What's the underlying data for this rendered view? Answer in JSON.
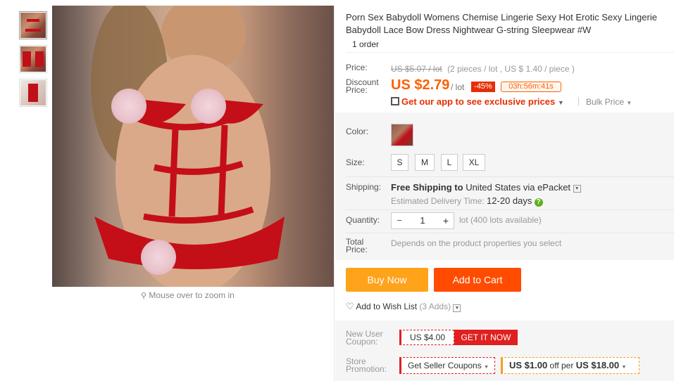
{
  "gallery": {
    "zoom_hint": "Mouse over to zoom in"
  },
  "product": {
    "title": "Porn Sex Babydoll Womens Chemise Lingerie Sexy Hot Erotic Sexy Lingerie Babydoll Lace Bow Dress Nightwear G-string Sleepwear #W",
    "orders": "1 order"
  },
  "price": {
    "label": "Price:",
    "original": "US $5.07 / lot",
    "original_note": "(2 pieces / lot , US $ 1.40 / piece )",
    "discount_label": "Discount Price:",
    "discount_value": "US $2.79",
    "discount_unit": "/ lot",
    "discount_pct": "-45%",
    "countdown": "03h:56m:41s",
    "app_promo": "Get our app to see exclusive prices",
    "bulk_price": "Bulk Price"
  },
  "options": {
    "color_label": "Color:",
    "size_label": "Size:",
    "sizes": [
      "S",
      "M",
      "L",
      "XL"
    ]
  },
  "shipping": {
    "label": "Shipping:",
    "free": "Free Shipping to",
    "dest": "United States via ePacket",
    "delivery_label": "Estimated Delivery Time:",
    "delivery_value": "12-20 days"
  },
  "quantity": {
    "label": "Quantity:",
    "value": "1",
    "available": "lot (400 lots available)",
    "minus": "−",
    "plus": "+"
  },
  "total": {
    "label": "Total Price:",
    "note": "Depends on the product properties you select"
  },
  "actions": {
    "buy_now": "Buy Now",
    "add_to_cart": "Add to Cart",
    "wishlist": "Add to Wish List",
    "wishlist_count": "(3 Adds)"
  },
  "coupons": {
    "new_user_label": "New User Coupon:",
    "new_user_value": "US $4.00",
    "get_it_now": "GET IT NOW",
    "store_label": "Store Promotion:",
    "seller_coupons": "Get Seller Coupons",
    "store_off_value": "US $1.00",
    "store_off_text": "off per",
    "store_off_min": "US $18.00"
  },
  "colors": {
    "price_orange": "#ff6000",
    "discount_badge": "#e62e04",
    "buy_now": "#ffa31a",
    "add_to_cart": "#ff4c00",
    "coupon_red": "#e02020"
  }
}
